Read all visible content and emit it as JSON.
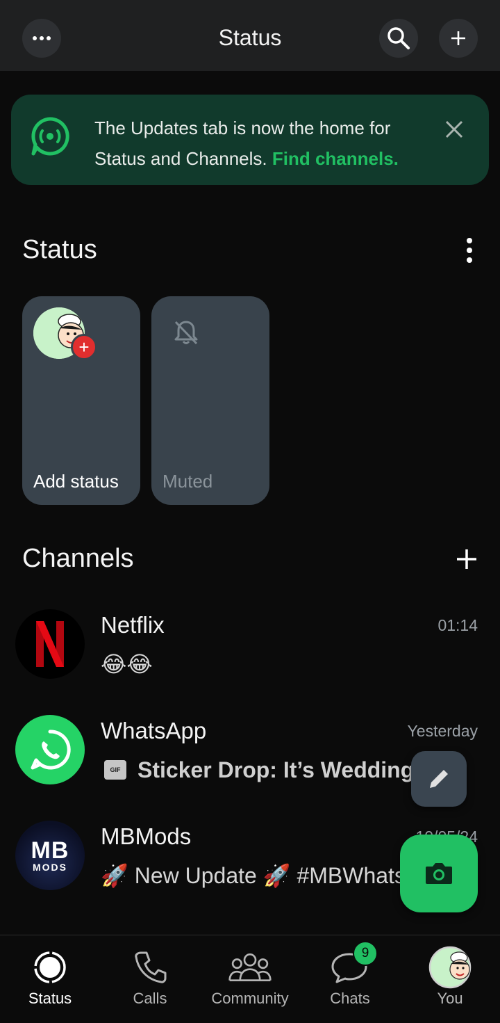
{
  "header": {
    "title": "Status"
  },
  "banner": {
    "text": "The Updates tab is now the home for Status and Channels.",
    "link": "Find channels."
  },
  "status_section": {
    "title": "Status",
    "cards": [
      {
        "label": "Add status"
      },
      {
        "label": "Muted"
      }
    ]
  },
  "channels_section": {
    "title": "Channels",
    "items": [
      {
        "name": "Netflix",
        "time": "01:14",
        "message": "😂😂"
      },
      {
        "name": "WhatsApp",
        "time": "Yesterday",
        "gif_label": "GIF",
        "message": "Sticker Drop: It’s Wedding S"
      },
      {
        "name": "MBMods",
        "time": "10/05/24",
        "message": "🚀 New Update 🚀  #MBWhatsApp",
        "logo_text": "MB",
        "logo_sub": "MODS"
      }
    ]
  },
  "bottom_nav": {
    "items": [
      {
        "label": "Status",
        "active": true
      },
      {
        "label": "Calls"
      },
      {
        "label": "Community"
      },
      {
        "label": "Chats",
        "badge": "9"
      },
      {
        "label": "You"
      }
    ]
  },
  "colors": {
    "accent": "#21c063",
    "banner_bg": "#113a2c",
    "card_bg": "#39434c",
    "topbar_bg": "#1f2021",
    "netflix_red": "#e50914"
  },
  "icons": [
    "more-horizontal-icon",
    "search-icon",
    "plus-icon",
    "channels-icon",
    "close-icon",
    "kebab-icon",
    "muted-bell-icon",
    "edit-pencil-icon",
    "camera-icon",
    "status-icon",
    "phone-icon",
    "community-icon",
    "chats-icon"
  ]
}
